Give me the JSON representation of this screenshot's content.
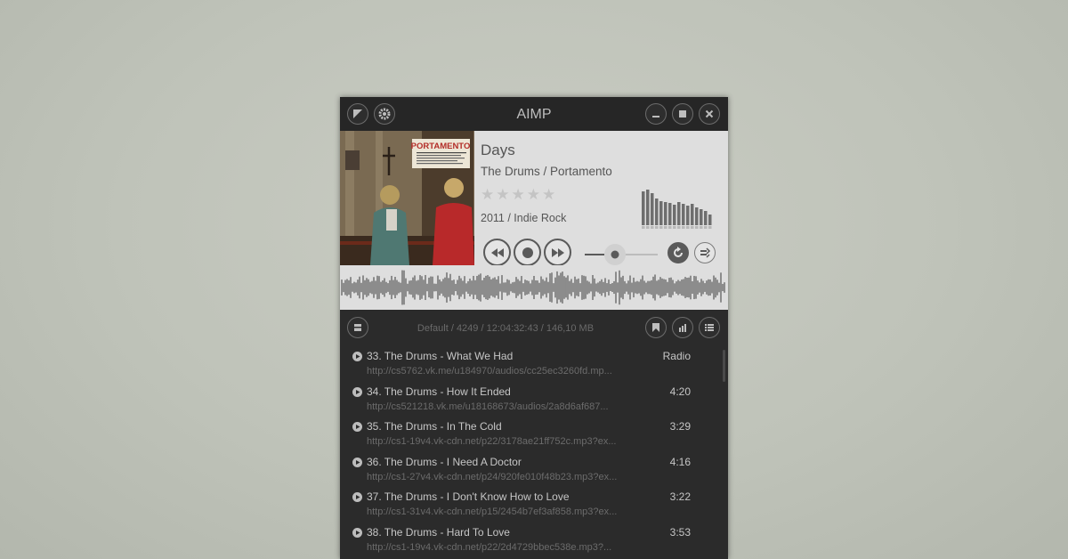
{
  "window": {
    "title": "AIMP"
  },
  "track": {
    "title": "Days",
    "artist_album": "The Drums / Portamento",
    "rating_stars": "★★★★★",
    "rating": 0,
    "year_genre": "2011 / Indie Rock",
    "cover_text": "PORTAMENTO"
  },
  "playlist_header": {
    "info": "Default / 4249 / 12:04:32:43 / 146,10 MB"
  },
  "playlist": [
    {
      "name": "33. The Drums - What We Had",
      "url": "http://cs5762.vk.me/u184970/audios/cc25ec3260fd.mp...",
      "duration": "Radio"
    },
    {
      "name": "34. The Drums - How It Ended",
      "url": "http://cs521218.vk.me/u18168673/audios/2a8d6af687...",
      "duration": "4:20"
    },
    {
      "name": "35. The Drums - In The Cold",
      "url": "http://cs1-19v4.vk-cdn.net/p22/3178ae21ff752c.mp3?ex...",
      "duration": "3:29"
    },
    {
      "name": "36. The Drums - I Need A Doctor",
      "url": "http://cs1-27v4.vk-cdn.net/p24/920fe010f48b23.mp3?ex...",
      "duration": "4:16"
    },
    {
      "name": "37. The Drums - I Don't Know How to Love",
      "url": "http://cs1-31v4.vk-cdn.net/p15/2454b7ef3af858.mp3?ex...",
      "duration": "3:22"
    },
    {
      "name": "38. The Drums - Hard To Love",
      "url": "http://cs1-19v4.vk-cdn.net/p22/2d4729bbec538e.mp3?...",
      "duration": "3:53"
    }
  ],
  "icons": {
    "menu": "corner-triangle-icon",
    "settings": "gear-icon",
    "minimize": "minimize-icon",
    "maximize": "maximize-icon",
    "close": "close-icon",
    "rewind": "rewind-icon",
    "stop": "stop-icon",
    "forward": "fast-forward-icon",
    "repeat": "repeat-icon",
    "shuffle": "shuffle-icon",
    "playlist_menu": "playlist-menu-icon",
    "bookmark": "bookmark-icon",
    "sort": "sort-icon",
    "list": "list-icon",
    "play": "play-circle-icon"
  },
  "colors": {
    "body_dark": "#2b2b2b",
    "titlebar": "#262626",
    "info_panel": "#dedede",
    "accent_text": "#555555"
  }
}
